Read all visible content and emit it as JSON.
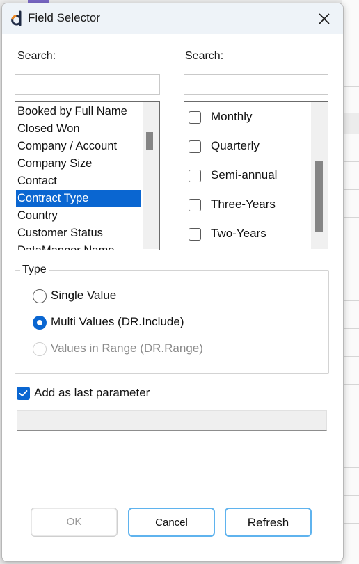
{
  "window": {
    "title": "Field Selector"
  },
  "left_panel": {
    "search_label": "Search:",
    "search_value": "",
    "fields": [
      {
        "label": "Booked by Full Name",
        "selected": false
      },
      {
        "label": "Closed Won",
        "selected": false
      },
      {
        "label": "Company / Account",
        "selected": false
      },
      {
        "label": "Company Size",
        "selected": false
      },
      {
        "label": "Contact",
        "selected": false
      },
      {
        "label": "Contract Type",
        "selected": true
      },
      {
        "label": "Country",
        "selected": false
      },
      {
        "label": "Customer Status",
        "selected": false
      },
      {
        "label": "DataMapper Name",
        "selected": false
      }
    ]
  },
  "right_panel": {
    "search_label": "Search:",
    "search_value": "",
    "values": [
      {
        "label": "Monthly",
        "checked": false
      },
      {
        "label": "Quarterly",
        "checked": false
      },
      {
        "label": "Semi-annual",
        "checked": false
      },
      {
        "label": "Three-Years",
        "checked": false
      },
      {
        "label": "Two-Years",
        "checked": false
      }
    ]
  },
  "type_group": {
    "title": "Type",
    "options": [
      {
        "label": "Single Value",
        "selected": false,
        "enabled": true
      },
      {
        "label": "Multi Values (DR.Include)",
        "selected": true,
        "enabled": true
      },
      {
        "label": "Values in Range (DR.Range)",
        "selected": false,
        "enabled": false
      }
    ]
  },
  "add_last_param": {
    "label": "Add as last parameter",
    "checked": true
  },
  "parameter_preview": "",
  "buttons": {
    "ok": "OK",
    "cancel": "Cancel",
    "refresh": "Refresh"
  },
  "colors": {
    "accent": "#0a66d1",
    "button_focus": "#5fb3ee",
    "title_bar": "#eef3f8"
  },
  "icons": {
    "app": "datarails-logo-icon",
    "close": "close-icon",
    "check": "checkmark-icon"
  }
}
